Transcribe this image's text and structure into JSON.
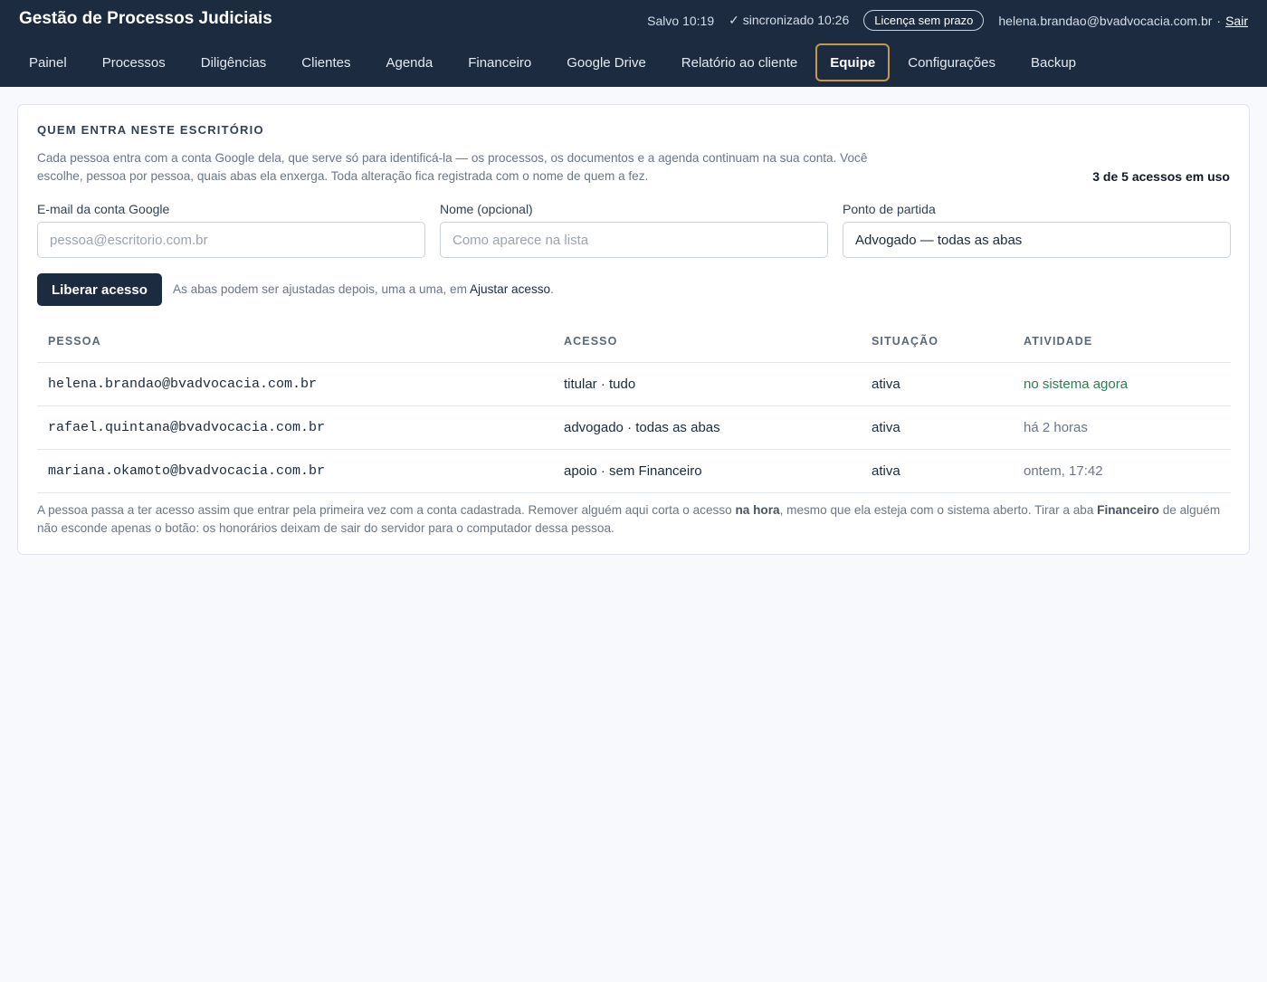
{
  "app": {
    "title": "Gestão de Processos Judiciais"
  },
  "status": {
    "saved": "Salvo 10:19",
    "sync": "✓ sincronizado 10:26",
    "license": "Licença sem prazo",
    "user": "helena.brandao@bvadvocacia.com.br",
    "separator": "·",
    "logout": "Sair"
  },
  "nav": {
    "items": [
      {
        "label": "Painel"
      },
      {
        "label": "Processos"
      },
      {
        "label": "Diligências"
      },
      {
        "label": "Clientes"
      },
      {
        "label": "Agenda"
      },
      {
        "label": "Financeiro"
      },
      {
        "label": "Google Drive"
      },
      {
        "label": "Relatório ao cliente"
      },
      {
        "label": "Equipe",
        "active": true
      },
      {
        "label": "Configurações"
      },
      {
        "label": "Backup"
      }
    ],
    "active_color": "#c49a4a"
  },
  "team": {
    "title": "QUEM ENTRA NESTE ESCRITÓRIO",
    "description": "Cada pessoa entra com a conta Google dela, que serve só para identificá-la — os processos, os documentos e a agenda continuam na sua conta. Você escolhe, pessoa por pessoa, quais abas ela enxerga. Toda alteração fica registrada com o nome de quem a fez.",
    "usage": "3 de 5 acessos em uso",
    "form": {
      "email_label": "E-mail da conta Google",
      "email_placeholder": "pessoa@escritorio.com.br",
      "name_label": "Nome (opcional)",
      "name_placeholder": "Como aparece na lista",
      "start_label": "Ponto de partida",
      "start_value": "Advogado — todas as abas",
      "submit": "Liberar acesso",
      "hint_prefix": "As abas podem ser ajustadas depois, uma a uma, em ",
      "hint_link": "Ajustar acesso",
      "hint_suffix": "."
    },
    "table": {
      "headers": [
        "PESSOA",
        "ACESSO",
        "SITUAÇÃO",
        "ATIVIDADE"
      ],
      "rows": [
        {
          "person": "helena.brandao@bvadvocacia.com.br",
          "access": "titular · tudo",
          "status": "ativa",
          "activity": "no sistema agora"
        },
        {
          "person": "rafael.quintana@bvadvocacia.com.br",
          "access": "advogado · todas as abas",
          "status": "ativa",
          "activity": "há 2 horas"
        },
        {
          "person": "mariana.okamoto@bvadvocacia.com.br",
          "access": "apoio · sem Financeiro",
          "status": "ativa",
          "activity": "ontem, 17:42"
        }
      ]
    },
    "footnote": {
      "part1": "A pessoa passa a ter acesso assim que entrar pela primeira vez com a conta cadastrada. Remover alguém aqui corta o acesso ",
      "bold1": "na hora",
      "part2": ", mesmo que ela esteja com o sistema aberto. Tirar a aba ",
      "bold2": "Financeiro",
      "part3": " de alguém não esconde apenas o botão: os honorários deixam de sair do servidor para o computador dessa pessoa."
    }
  },
  "colors": {
    "header_bg": "#1c2b40",
    "online": "#2e7d4f",
    "accent": "#c49a4a"
  }
}
